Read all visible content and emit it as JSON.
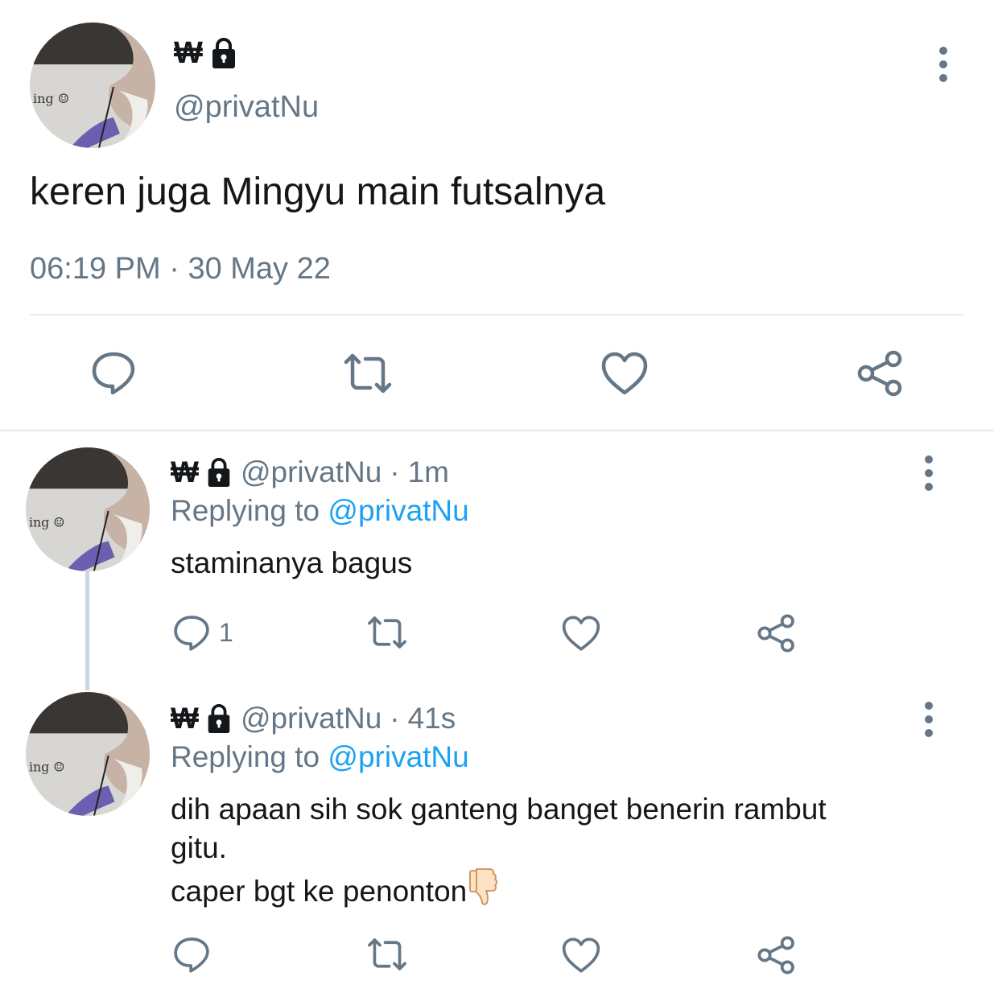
{
  "main_tweet": {
    "name": "₩",
    "handle": "@privatNu",
    "text": "keren juga Mingyu main futsalnya",
    "time": "06:19 PM",
    "separator": "·",
    "date": "30 May 22",
    "avatar_text": "ing ☺",
    "icons": [
      "lock-icon",
      "more-icon",
      "reply-icon",
      "retweet-icon",
      "like-icon",
      "share-icon"
    ]
  },
  "replies": [
    {
      "name": "₩",
      "handle": "@privatNu",
      "separator": "·",
      "time": "1m",
      "replying_prefix": "Replying to",
      "replying_to": "@privatNu",
      "text": "staminanya bagus",
      "reply_count": "1",
      "avatar_text": "ing ☺"
    },
    {
      "name": "₩",
      "handle": "@privatNu",
      "separator": "·",
      "time": "41s",
      "replying_prefix": "Replying to",
      "replying_to": "@privatNu",
      "text_line1": "dih apaan sih sok ganteng banget benerin rambut",
      "text_line2": "gitu.",
      "text_line3": "caper bgt ke penonton",
      "emoji": "thumbs-down-icon",
      "avatar_text": "ing ☺"
    }
  ],
  "colors": {
    "primary_text": "#14171a",
    "secondary_text": "#657786",
    "link": "#1da1f2",
    "divider": "#e6ecf0"
  }
}
